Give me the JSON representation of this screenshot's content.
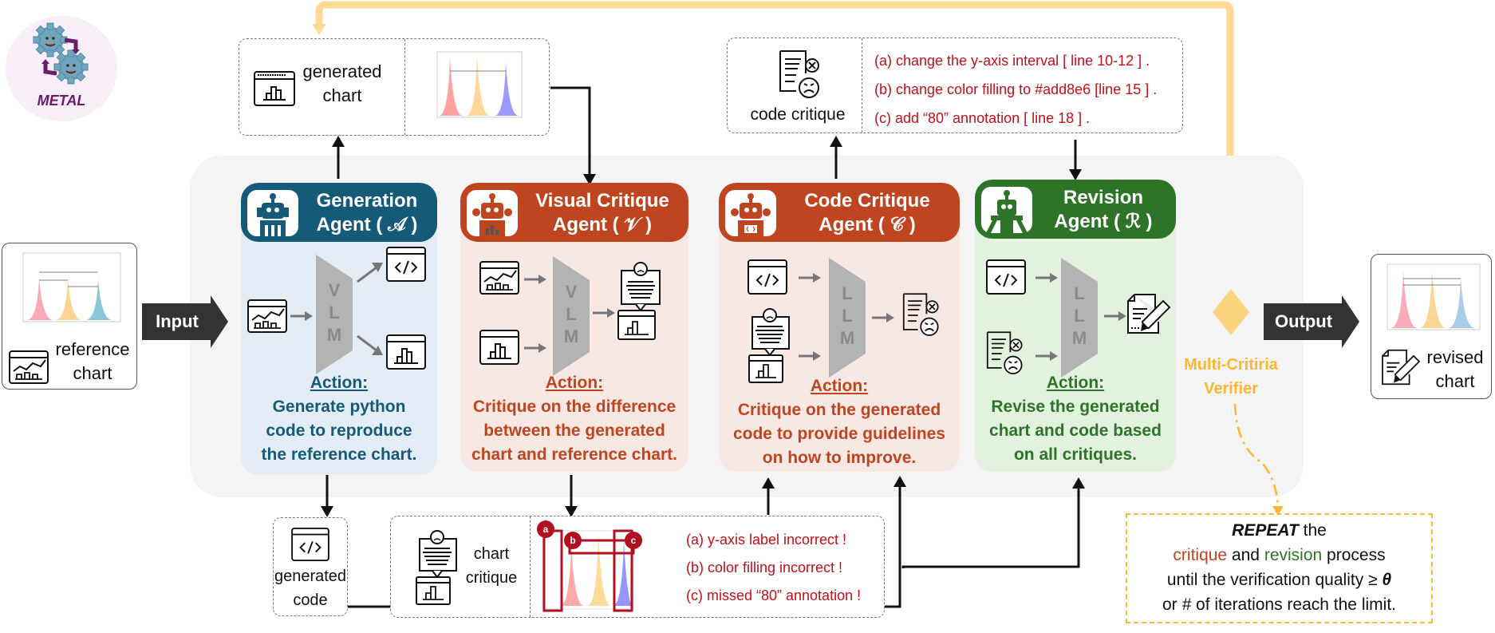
{
  "logo": {
    "text": "METAL"
  },
  "input": {
    "arrow_label": "Input",
    "reference_chart_label_1": "reference",
    "reference_chart_label_2": "chart"
  },
  "output": {
    "arrow_label": "Output",
    "revised_chart_label_1": "revised",
    "revised_chart_label_2": "chart"
  },
  "generated_chart_box": {
    "label_1": "generated",
    "label_2": "chart"
  },
  "code_critique_box": {
    "label": "code critique",
    "items": [
      "(a) change the y-axis interval  [ line 10-12 ] .",
      "(b) change color filling to #add8e6  [line 15 ] .",
      "(c)  add “80” annotation [ line 18 ] ."
    ]
  },
  "generated_code_box": {
    "label_1": "generated",
    "label_2": "code"
  },
  "chart_critique_box": {
    "label_1": "chart",
    "label_2": "critique",
    "markers": [
      "a",
      "b",
      "c"
    ],
    "items": [
      "(a) y-axis label incorrect !",
      "(b) color filling incorrect !",
      "(c) missed “80” annotation !"
    ]
  },
  "agents": [
    {
      "id": "generation",
      "title_1": "Generation",
      "title_2": "Agent  ( 𝒜 )",
      "model": [
        "V",
        "L",
        "M"
      ],
      "action_label": "Action:",
      "action_lines": [
        "Generate python",
        "code to reproduce",
        "the reference chart."
      ],
      "header_color": "#155a78",
      "body_color": "#e4edf5",
      "text_color": "#155a78"
    },
    {
      "id": "visual-critique",
      "title_1": "Visual Critique",
      "title_2": "Agent ( 𝒱 )",
      "model": [
        "V",
        "L",
        "M"
      ],
      "action_label": "Action:",
      "action_lines": [
        "Critique on the difference",
        "between the generated",
        "chart and reference chart."
      ],
      "header_color": "#bf4520",
      "body_color": "#f7e8e3",
      "text_color": "#bf4520"
    },
    {
      "id": "code-critique",
      "title_1": "Code Critique",
      "title_2": "Agent ( 𝒞 )",
      "model": [
        "L",
        "L",
        "M"
      ],
      "action_label": "Action:",
      "action_lines": [
        "Critique on the generated",
        "code to provide guidelines",
        "on how to improve."
      ],
      "header_color": "#bf4520",
      "body_color": "#f7e8e3",
      "text_color": "#bf4520"
    },
    {
      "id": "revision",
      "title_1": "Revision",
      "title_2": "Agent ( ℛ )",
      "model": [
        "L",
        "L",
        "M"
      ],
      "action_label": "Action:",
      "action_lines": [
        "Revise the generated",
        "chart and code based",
        "on all critiques."
      ],
      "header_color": "#2d7428",
      "body_color": "#e2f2df",
      "text_color": "#2d7428"
    }
  ],
  "verifier": {
    "label_1": "Multi-Critiria",
    "label_2": "Verifier",
    "color": "#fbb731"
  },
  "repeat_box": {
    "word_repeat": "REPEAT",
    "word_the": " the",
    "word_critique": "critique",
    "word_and": " and ",
    "word_revision": "revision",
    "word_process": " process",
    "line3": "until the verification quality ≥ ",
    "theta": "θ",
    "line4_hash": "#",
    "line4_pre": "or ",
    "line4_rest": " of iterations reach the limit."
  }
}
